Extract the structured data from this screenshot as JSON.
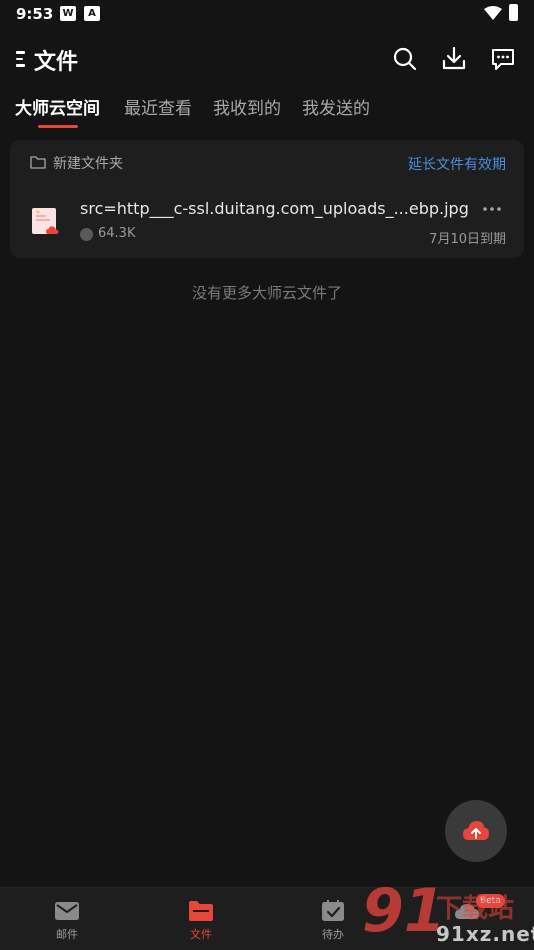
{
  "status_bar": {
    "time": "9:53",
    "app_icon_w": "W",
    "app_icon_a": "A"
  },
  "header": {
    "title": "文件",
    "icons": [
      "menu-icon",
      "search-icon",
      "download-icon",
      "message-icon"
    ]
  },
  "tabs": [
    {
      "label": "大师云空间",
      "active": true
    },
    {
      "label": "最近查看",
      "active": false
    },
    {
      "label": "我收到的",
      "active": false
    },
    {
      "label": "我发送的",
      "active": false
    }
  ],
  "file_card": {
    "new_folder_label": "新建文件夹",
    "extend_link": "延长文件有效期",
    "files": [
      {
        "name": "src=http___c-ssl.duitang.com_uploads_...ebp.jpg",
        "size": "64.3K",
        "expire": "7月10日到期"
      }
    ]
  },
  "no_more_text": "没有更多大师云文件了",
  "bottom_nav": {
    "items": [
      {
        "label": "邮件",
        "icon": "mail-icon",
        "active": false
      },
      {
        "label": "文件",
        "icon": "folder-icon",
        "active": true
      },
      {
        "label": "待办",
        "icon": "todo-icon",
        "active": false
      },
      {
        "label": "",
        "icon": "cloud-icon",
        "active": false
      }
    ],
    "badge": "Beta"
  },
  "watermark": {
    "big": "91",
    "chinese": "下载站",
    "domain": "91xz.net"
  },
  "colors": {
    "background": "#141414",
    "card": "#1e1e1e",
    "accent_red": "#e8453c",
    "link_blue": "#4a8fe0"
  }
}
